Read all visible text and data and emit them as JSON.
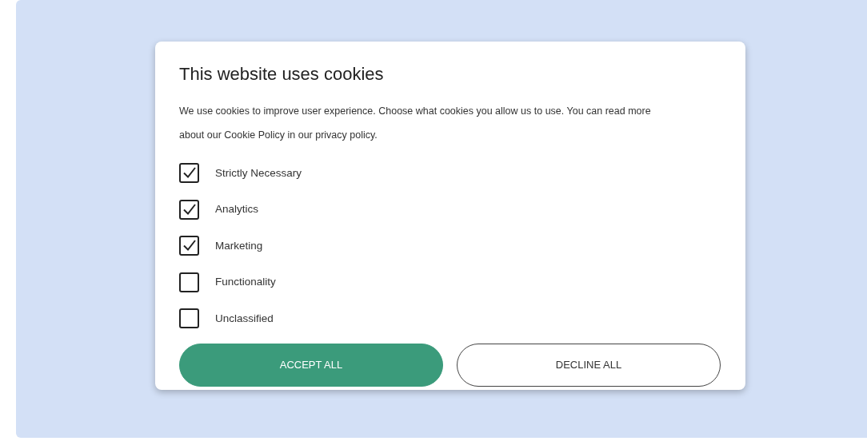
{
  "dialog": {
    "title": "This website uses cookies",
    "description": "We use cookies to improve user experience. Choose what cookies you allow us to use. You can read more about our Cookie Policy in our privacy policy.",
    "options": [
      {
        "label": "Strictly Necessary",
        "checked": true
      },
      {
        "label": "Analytics",
        "checked": true
      },
      {
        "label": "Marketing",
        "checked": true
      },
      {
        "label": "Functionality",
        "checked": false
      },
      {
        "label": "Unclassified",
        "checked": false
      }
    ],
    "buttons": [
      {
        "label": "ACCEPT ALL",
        "kind": "primary"
      },
      {
        "label": "DECLINE ALL",
        "kind": "secondary"
      }
    ]
  }
}
